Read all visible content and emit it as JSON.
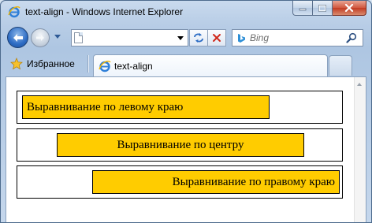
{
  "window": {
    "title": "text-align - Windows Internet Explorer"
  },
  "navigation": {
    "address_value": "",
    "search_placeholder": "Bing"
  },
  "favorites": {
    "label": "Избранное"
  },
  "tab": {
    "label": "text-align"
  },
  "content": {
    "blocks": [
      {
        "text": "Выравнивание по левому краю",
        "align": "left"
      },
      {
        "text": "Выравнивание по центру",
        "align": "center"
      },
      {
        "text": "Выравнивание по правому краю",
        "align": "right"
      }
    ],
    "highlight_color": "#ffcc00",
    "border_color": "#000000"
  },
  "icons": {
    "app": "internet-explorer-icon",
    "minimize": "minimize-icon",
    "maximize": "maximize-icon",
    "close": "close-icon",
    "back": "back-arrow-icon",
    "forward": "forward-arrow-icon",
    "refresh": "refresh-icon",
    "stop": "stop-icon",
    "search_engine": "bing-icon",
    "search": "magnifier-icon",
    "favorites": "star-icon"
  }
}
